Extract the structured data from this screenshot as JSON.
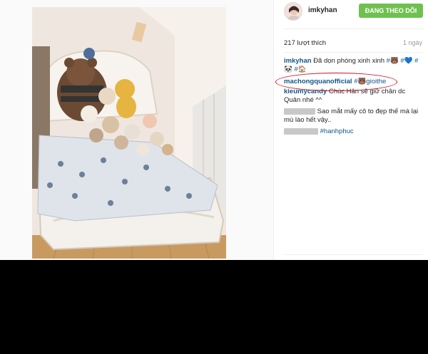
{
  "header": {
    "username": "imkyhan",
    "follow_label": "ĐANG THEO DÕI"
  },
  "meta": {
    "likes": "217 lượt thích",
    "time": "1 ngày"
  },
  "comments": {
    "c1": {
      "user": "imkyhan",
      "text": "Đã dọn phòng xinh xinh",
      "tags_line1": "#🐻 #💙 #",
      "tags_line2": "🐼 #🏠"
    },
    "c2": {
      "user": "machongquanofficial",
      "tag": "#🐻gioithe"
    },
    "c3": {
      "user": "kieumycandy",
      "text": "Chúc Hân sẽ giữ chân dc Quân nhé ^^"
    },
    "c4": {
      "text": "Sao mắt mấy cô to đẹp thế mà lại mù lào hết vậy.."
    },
    "c5": {
      "tag": "#hanhphuc"
    }
  },
  "colors": {
    "follow_bg": "#70c050",
    "link": "#125688",
    "highlight": "#d01020"
  }
}
